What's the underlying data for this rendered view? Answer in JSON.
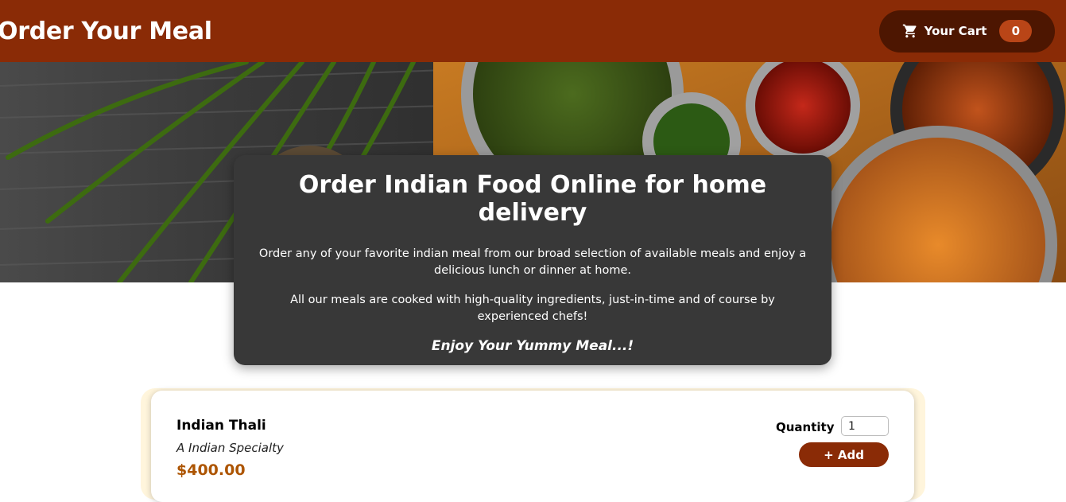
{
  "header": {
    "title": "Order Your Meal",
    "cart": {
      "label": "Your Cart",
      "count": "0",
      "icon": "cart-icon"
    }
  },
  "hero": {
    "image": "indian-food-banner-image"
  },
  "summary": {
    "heading": "Order Indian Food Online for home delivery",
    "paragraph1": "Order any of your favorite indian meal from our broad selection of available meals and enjoy a delicious lunch or dinner at home.",
    "paragraph2": "All our meals are cooked with high-quality ingredients, just-in-time and of course by experienced chefs!",
    "tagline": "Enjoy Your Yummy Meal...!"
  },
  "meals": [
    {
      "name": "Indian Thali",
      "description": "A Indian Specialty",
      "price": "$400.00",
      "quantity_label": "Quantity",
      "quantity_value": "1",
      "add_label": "+ Add"
    }
  ],
  "colors": {
    "header": "#8a2b06",
    "cart_button": "#4d1601",
    "badge": "#b94517",
    "summary_bg": "#383838",
    "price": "#ad5502"
  }
}
